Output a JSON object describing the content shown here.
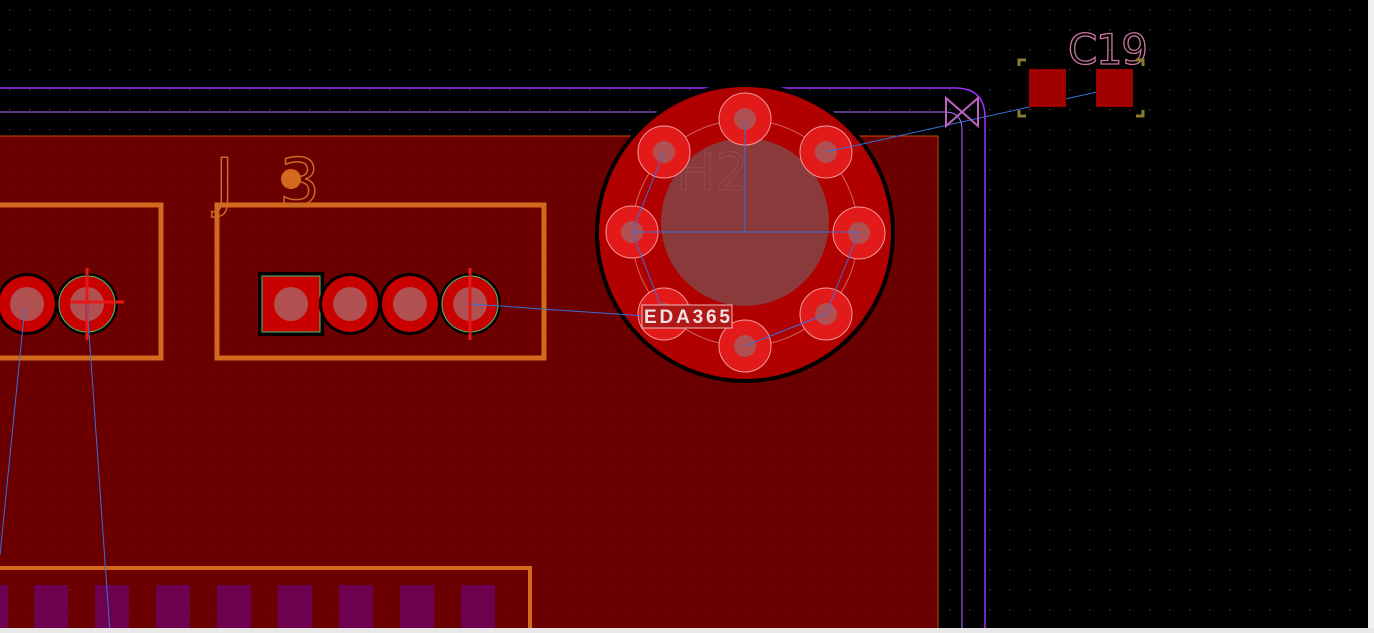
{
  "app": {
    "view": "PCB Editor Canvas"
  },
  "components": {
    "j3": {
      "ref": "J3"
    },
    "c19": {
      "ref": "C19"
    },
    "mh2": {
      "ref": "H2"
    }
  },
  "nets": {
    "net_label": "EDA365"
  },
  "colors": {
    "background": "#000000",
    "grid_dot": "#3a3a3a",
    "copper_fill": "#6b0000",
    "pad_red": "#c80000",
    "pad_ring": "#e21a1a",
    "pad_hole": "#b05050",
    "silkscreen": "#d2691e",
    "courtyard_purple": "#9b30ff",
    "ratsnest": "#3a6ed8",
    "c19_text": "#c8789e",
    "mask_purple": "#6e0050",
    "net_label_bg": "#b01818"
  }
}
